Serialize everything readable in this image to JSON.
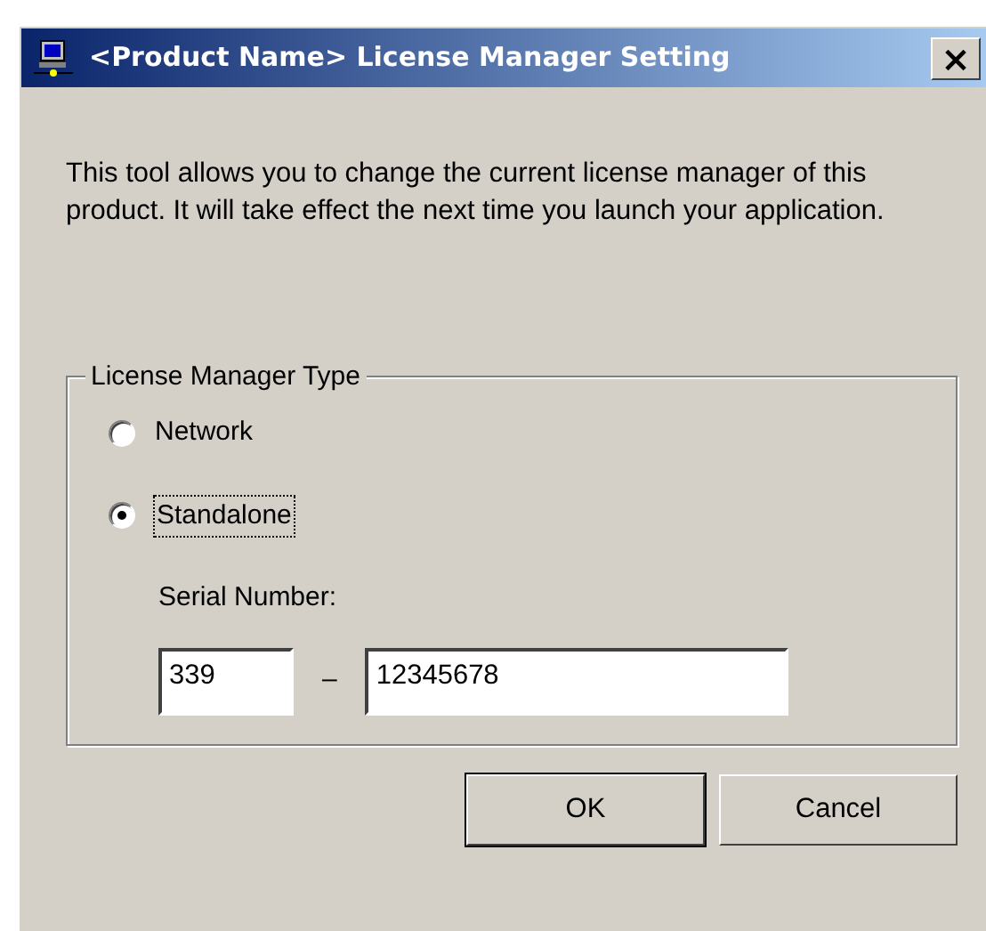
{
  "window": {
    "title": "<Product Name> License Manager Setting",
    "close": "×"
  },
  "description": "This tool allows you to change the current license manager of this product.  It will take effect the next time you launch your application.",
  "group": {
    "legend": "License Manager Type",
    "options": [
      {
        "label": "Network",
        "selected": false,
        "focused": false
      },
      {
        "label": "Standalone",
        "selected": true,
        "focused": true
      }
    ],
    "serial": {
      "label": "Serial Number:",
      "prefix": "339",
      "separator": "–",
      "number": "12345678"
    }
  },
  "buttons": [
    {
      "label": "OK",
      "default": true
    },
    {
      "label": "Cancel",
      "default": false
    }
  ]
}
